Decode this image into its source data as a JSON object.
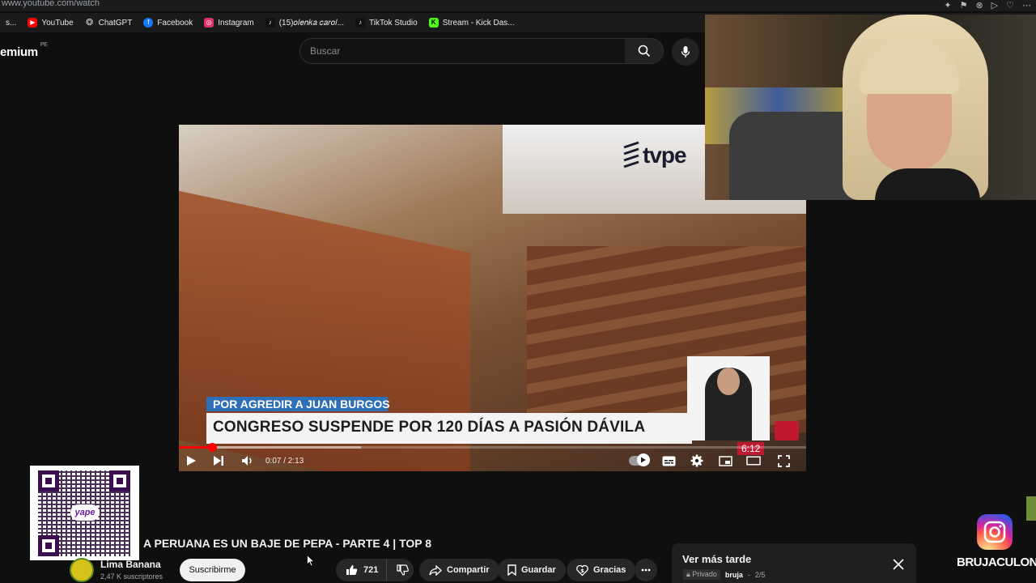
{
  "browser": {
    "url": "www.youtube.com/watch"
  },
  "bookmarks": [
    {
      "label": "s...",
      "icon": "folder-icon",
      "color": "#888888"
    },
    {
      "label": "YouTube",
      "icon": "youtube-icon",
      "color": "#ff0000"
    },
    {
      "label": "ChatGPT",
      "icon": "chatgpt-icon",
      "color": "#cccccc"
    },
    {
      "label": "Facebook",
      "icon": "facebook-icon",
      "color": "#1877f2"
    },
    {
      "label": "Instagram",
      "icon": "instagram-icon",
      "color": "#e1306c"
    },
    {
      "label": "(15)𝑜𝑙𝑒𝑛𝑘𝑎 𝑐𝑎𝑟𝑜𝑙...",
      "icon": "tiktok-icon",
      "color": "#111111"
    },
    {
      "label": "TikTok Studio",
      "icon": "tiktok-icon",
      "color": "#111111"
    },
    {
      "label": "Stream - Kick Das...",
      "icon": "kick-icon",
      "color": "#53fc18"
    }
  ],
  "header": {
    "logo_fragment": "emium",
    "country": "PE",
    "search_placeholder": "Buscar"
  },
  "player": {
    "news_subtitle": "POR AGREDIR A JUAN BURGOS",
    "news_headline": "CONGRESO SUSPENDE POR 120 DÍAS A PASIÓN DÁVILA",
    "broadcaster": "tvpe",
    "news_clock": "6:12",
    "time_display": "0:07 / 2:13",
    "progress_fraction": 0.053,
    "buffer_fraction": 0.29
  },
  "video": {
    "title": "A PERUANA ES UN BAJE DE PEPA - PARTE 4 | TOP 8",
    "channel": "Lima Banana",
    "subscribers": "2,47 K suscriptores",
    "subscribe_label": "Suscribirme",
    "likes": "721",
    "share_label": "Compartir",
    "save_label": "Guardar",
    "thanks_label": "Gracias"
  },
  "watch_later": {
    "title": "Ver más tarde",
    "privacy": "Privado",
    "owner": "bruja",
    "position": "2/5"
  },
  "overlay": {
    "qr_brand": "yape",
    "instagram_handle": "BRUJACULONA"
  }
}
